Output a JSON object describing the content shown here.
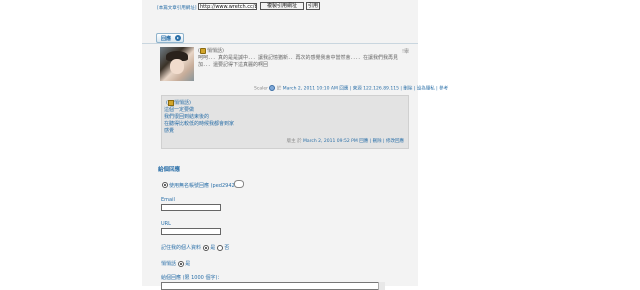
{
  "trackback": {
    "label": "[本篇文章引用網址]",
    "url": "http://www.wretch.cc/blog",
    "copy_label": "複製引用網址",
    "quote_label": "引用"
  },
  "reply_tab": {
    "label": "回應"
  },
  "comment": {
    "author": "悄悄話",
    "flag": "!舉",
    "body": "呵呵．．．真的是是誠中．．．讓我記憶猶新．．再次的感覺我會中當然會．．．．在讓我們我再見 加．．．還要記得下這真麗的啊回",
    "meta_prefix": "Scaler",
    "meta_on": "於",
    "meta_time": "March 2, 2011 10:10 AM",
    "meta_links": [
      "回應",
      "| 來源 122.126.89.115",
      "| 刪除",
      "| 設為隱私",
      "| 參考"
    ]
  },
  "host_reply": {
    "author": "悄悄話",
    "lines": [
      "這個一定要做",
      "我們很回到結束後的",
      "在聽得比較低的時候我都會到家",
      "感覺"
    ],
    "meta_prefix": "版主 於",
    "meta_time": "March 2, 2011 09:52 PM",
    "meta_links": [
      "回應",
      "| 刪除",
      "| 修改回應"
    ]
  },
  "form": {
    "title": "給個回應",
    "member_label": "使用無名帳號回應 (ped2942G)",
    "email_label": "Email",
    "url_label": "URL",
    "remember_label": "記住我的個人資料",
    "remember_yes": "是",
    "remember_no": "否",
    "private_label": "悄悄話",
    "private_yes": "是",
    "content_label": "給個回應 (限 1000 個字)："
  }
}
